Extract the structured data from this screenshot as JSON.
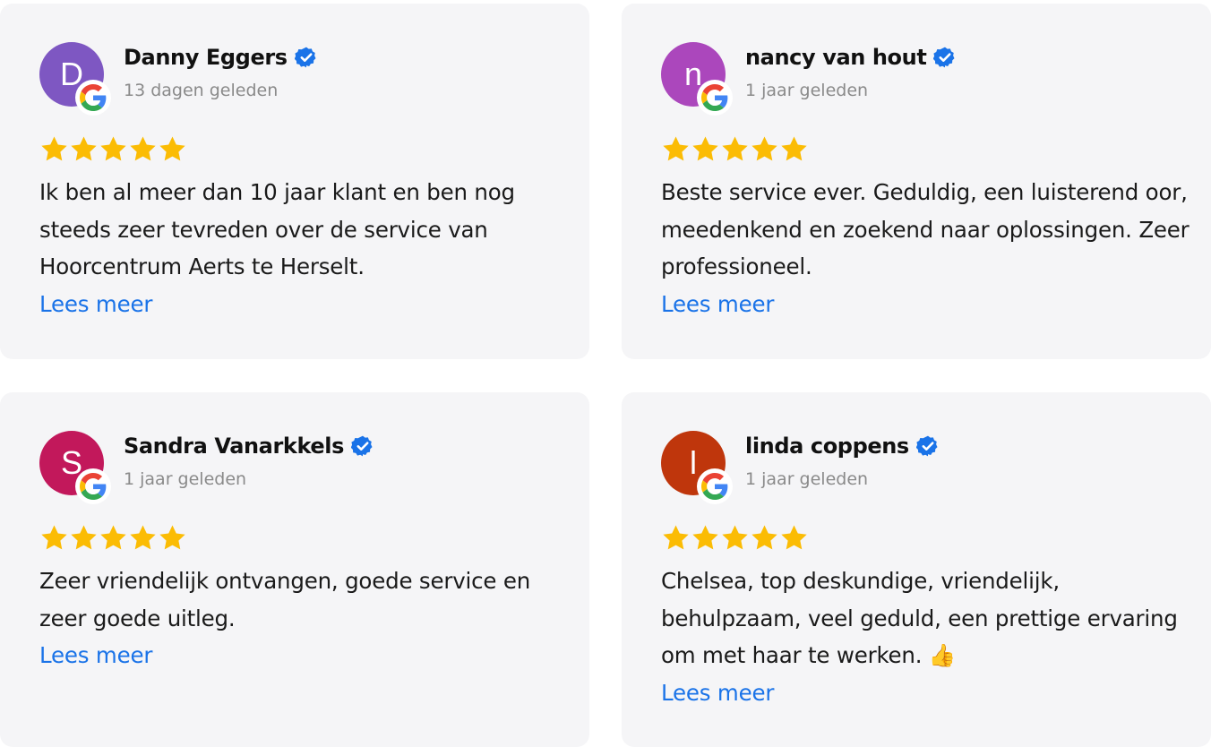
{
  "colors": {
    "card_background": "#f5f5f7",
    "link": "#1a73e8",
    "star": "#fbbc04",
    "verified": "#1a73e8"
  },
  "reviews": [
    {
      "initial": "D",
      "avatar_color": "#7e57c2",
      "name": "Danny Eggers",
      "date": "13 dagen geleden",
      "rating": 5,
      "text": "Ik ben al meer dan 10 jaar klant en ben nog steeds zeer tevreden over de service van Hoorcentrum Aerts te Herselt.",
      "more_label": "Lees meer"
    },
    {
      "initial": "n",
      "avatar_color": "#ab47bc",
      "name": "nancy van hout",
      "date": "1 jaar geleden",
      "rating": 5,
      "text": "Beste service ever. Geduldig, een luisterend oor, meedenkend en zoekend naar oplossingen. Zeer professioneel.",
      "more_label": "Lees meer"
    },
    {
      "initial": "S",
      "avatar_color": "#c2185b",
      "name": "Sandra Vanarkkels",
      "date": "1 jaar geleden",
      "rating": 5,
      "text": "Zeer vriendelijk ontvangen, goede service en zeer goede uitleg.",
      "more_label": "Lees meer"
    },
    {
      "initial": "l",
      "avatar_color": "#bf360c",
      "name": "linda coppens",
      "date": "1 jaar geleden",
      "rating": 5,
      "text": "Chelsea, top deskundige, vriendelijk, behulpzaam, veel geduld, een prettige ervaring om met haar te werken. 👍",
      "more_label": "Lees meer"
    }
  ]
}
